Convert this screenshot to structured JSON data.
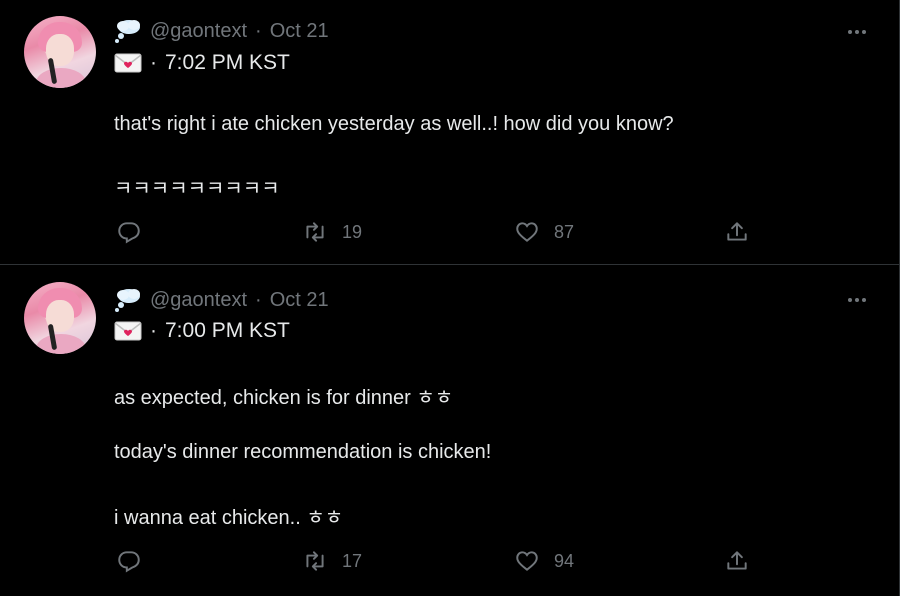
{
  "colors": {
    "background": "#000000",
    "text": "#e7e9ea",
    "secondary": "#71767b",
    "divider": "#2f3336"
  },
  "tweets": [
    {
      "handle": "@gaontext",
      "separator": "·",
      "date": "Oct 21",
      "time_prefix": "·",
      "time": "7:02 PM KST",
      "lines": [
        "that's right i ate chicken yesterday as well..! how did you know?",
        "ㅋㅋㅋㅋㅋㅋㅋㅋㅋ"
      ],
      "retweets": "19",
      "likes": "87"
    },
    {
      "handle": "@gaontext",
      "separator": "·",
      "date": "Oct 21",
      "time_prefix": "·",
      "time": "7:00 PM KST",
      "lines": [
        "as expected, chicken is for dinner ㅎㅎ",
        "today's dinner recommendation is chicken!",
        "i wanna eat chicken.. ㅎㅎ"
      ],
      "retweets": "17",
      "likes": "94"
    }
  ],
  "icons": {
    "header_emoji": "thought-bubble-icon",
    "time_emoji": "love-letter-icon",
    "more": "more-icon",
    "reply": "reply-icon",
    "retweet": "retweet-icon",
    "like": "heart-icon",
    "share": "share-icon"
  }
}
